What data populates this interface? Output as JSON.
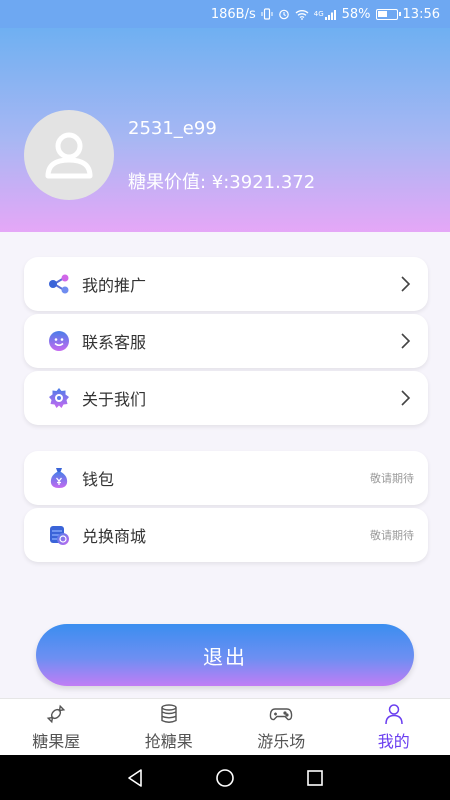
{
  "status_bar": {
    "network_speed": "186B/s",
    "network_type": "4G",
    "battery": "58%",
    "time": "13:56"
  },
  "profile": {
    "username": "2531_e99",
    "value_text": "糖果价值: ¥:3921.372"
  },
  "menu": {
    "group1": [
      {
        "label": "我的推广",
        "icon": "share-icon"
      },
      {
        "label": "联系客服",
        "icon": "customer-service-icon"
      },
      {
        "label": "关于我们",
        "icon": "about-icon"
      }
    ],
    "group2": [
      {
        "label": "钱包",
        "icon": "wallet-icon",
        "status": "敬请期待"
      },
      {
        "label": "兑换商城",
        "icon": "exchange-mall-icon",
        "status": "敬请期待"
      }
    ]
  },
  "logout_label": "退出",
  "tabs": [
    {
      "label": "糖果屋",
      "icon": "candy-icon"
    },
    {
      "label": "抢糖果",
      "icon": "coins-icon"
    },
    {
      "label": "游乐场",
      "icon": "gamepad-icon"
    },
    {
      "label": "我的",
      "icon": "person-icon",
      "active": true
    }
  ],
  "colors": {
    "accent": "#6a3ef0",
    "header_top": "#6fb0f2",
    "header_bottom": "#e5a7f7"
  }
}
